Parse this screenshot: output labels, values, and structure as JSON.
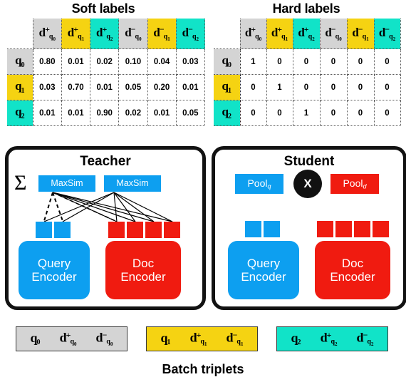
{
  "soft_table": {
    "title": "Soft labels",
    "col_headers": [
      {
        "d": "d",
        "sign": "+",
        "q": "q",
        "idx": "0",
        "color": "#d4d4d4"
      },
      {
        "d": "d",
        "sign": "+",
        "q": "q",
        "idx": "1",
        "color": "#f5d312"
      },
      {
        "d": "d",
        "sign": "+",
        "q": "q",
        "idx": "2",
        "color": "#11e3c8"
      },
      {
        "d": "d",
        "sign": "−",
        "q": "q",
        "idx": "0",
        "color": "#d4d4d4"
      },
      {
        "d": "d",
        "sign": "−",
        "q": "q",
        "idx": "1",
        "color": "#f5d312"
      },
      {
        "d": "d",
        "sign": "−",
        "q": "q",
        "idx": "2",
        "color": "#11e3c8"
      }
    ],
    "row_headers": [
      {
        "q": "q",
        "idx": "0",
        "color": "#d4d4d4"
      },
      {
        "q": "q",
        "idx": "1",
        "color": "#f5d312"
      },
      {
        "q": "q",
        "idx": "2",
        "color": "#11e3c8"
      }
    ],
    "rows": [
      [
        "0.80",
        "0.01",
        "0.02",
        "0.10",
        "0.04",
        "0.03"
      ],
      [
        "0.03",
        "0.70",
        "0.01",
        "0.05",
        "0.20",
        "0.01"
      ],
      [
        "0.01",
        "0.01",
        "0.90",
        "0.02",
        "0.01",
        "0.05"
      ]
    ]
  },
  "hard_table": {
    "title": "Hard labels",
    "col_headers": [
      {
        "d": "d",
        "sign": "+",
        "q": "q",
        "idx": "0",
        "color": "#d4d4d4"
      },
      {
        "d": "d",
        "sign": "+",
        "q": "q",
        "idx": "1",
        "color": "#f5d312"
      },
      {
        "d": "d",
        "sign": "+",
        "q": "q",
        "idx": "2",
        "color": "#11e3c8"
      },
      {
        "d": "d",
        "sign": "−",
        "q": "q",
        "idx": "0",
        "color": "#d4d4d4"
      },
      {
        "d": "d",
        "sign": "−",
        "q": "q",
        "idx": "1",
        "color": "#f5d312"
      },
      {
        "d": "d",
        "sign": "−",
        "q": "q",
        "idx": "2",
        "color": "#11e3c8"
      }
    ],
    "row_headers": [
      {
        "q": "q",
        "idx": "0",
        "color": "#d4d4d4"
      },
      {
        "q": "q",
        "idx": "1",
        "color": "#f5d312"
      },
      {
        "q": "q",
        "idx": "2",
        "color": "#11e3c8"
      }
    ],
    "rows": [
      [
        "1",
        "0",
        "0",
        "0",
        "0",
        "0"
      ],
      [
        "0",
        "1",
        "0",
        "0",
        "0",
        "0"
      ],
      [
        "0",
        "0",
        "1",
        "0",
        "0",
        "0"
      ]
    ]
  },
  "teacher": {
    "title": "Teacher",
    "sigma": "Σ",
    "maxsim_left": "MaxSim",
    "maxsim_right": "MaxSim",
    "query_encoder": "Query\nEncoder",
    "query_encoder_line1": "Query",
    "query_encoder_line2": "Encoder",
    "doc_encoder_line1": "Doc",
    "doc_encoder_line2": "Encoder",
    "query_token_count": 2,
    "doc_token_count": 4
  },
  "student": {
    "title": "Student",
    "pool_q_base": "Pool",
    "pool_q_sub": "q",
    "pool_d_base": "Pool",
    "pool_d_sub": "d",
    "operator": "X",
    "query_encoder_line1": "Query",
    "query_encoder_line2": "Encoder",
    "doc_encoder_line1": "Doc",
    "doc_encoder_line2": "Encoder",
    "query_token_count": 2,
    "doc_token_count": 4
  },
  "batch": {
    "caption": "Batch triplets",
    "triplets": [
      {
        "q": "q",
        "idx": "0",
        "pos_sign": "+",
        "neg_sign": "−",
        "d": "d",
        "color": "#d4d4d4"
      },
      {
        "q": "q",
        "idx": "1",
        "pos_sign": "+",
        "neg_sign": "−",
        "d": "d",
        "color": "#f5d312"
      },
      {
        "q": "q",
        "idx": "2",
        "pos_sign": "+",
        "neg_sign": "−",
        "d": "d",
        "color": "#11e3c8"
      }
    ]
  },
  "colors": {
    "gray": "#d4d4d4",
    "yellow": "#f5d312",
    "cyan": "#11e3c8",
    "blue": "#0d9ff0",
    "red": "#f01b10",
    "black": "#111111"
  }
}
